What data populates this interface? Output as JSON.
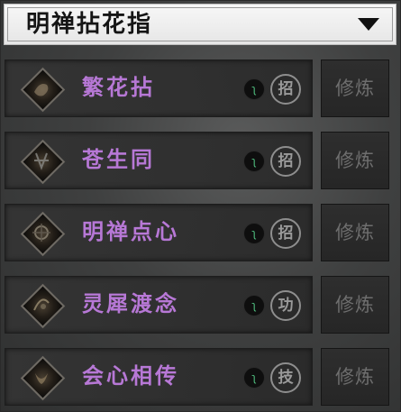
{
  "header": {
    "title": "明禅拈花指"
  },
  "skills": [
    {
      "name": "繁花拈",
      "type": "招",
      "mini": "ʅ",
      "action": "修炼"
    },
    {
      "name": "苍生同",
      "type": "招",
      "mini": "ʅ",
      "action": "修炼"
    },
    {
      "name": "明禅点心",
      "type": "招",
      "mini": "ʅ",
      "action": "修炼"
    },
    {
      "name": "灵犀渡念",
      "type": "功",
      "mini": "ʅ",
      "action": "修炼"
    },
    {
      "name": "会心相传",
      "type": "技",
      "mini": "ʅ",
      "action": "修炼"
    }
  ],
  "colors": {
    "skill_name": "#b778d6",
    "mini_icon": "#4fbf7f"
  }
}
